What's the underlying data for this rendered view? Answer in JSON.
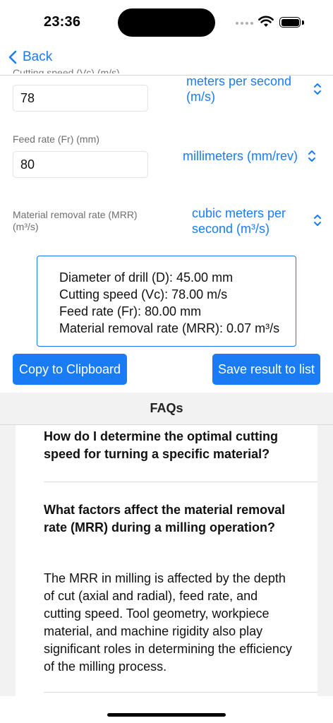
{
  "status": {
    "time": "23:36"
  },
  "nav": {
    "back_label": "Back"
  },
  "fields": {
    "cutting_speed": {
      "label_partial": "Cutting speed (Vc) (m/s)",
      "value": "78",
      "unit": "meters per second (m/s)"
    },
    "feed_rate": {
      "label": "Feed rate (Fr) (mm)",
      "value": "80",
      "unit": "millimeters (mm/rev)"
    },
    "mrr": {
      "label_line1": "Material removal rate (MRR)",
      "label_line2": "(m³/s)",
      "unit_line1": "cubic meters per",
      "unit_line2": "second (m³/s)"
    }
  },
  "result": {
    "lines": [
      "Diameter of drill (D): 45.00 mm",
      "Cutting speed (Vc): 78.00 m/s",
      "Feed rate (Fr): 80.00 mm",
      "Material removal rate (MRR): 0.07 m³/s"
    ]
  },
  "buttons": {
    "copy": "Copy to Clipboard",
    "save": "Save result to list"
  },
  "faqs": {
    "title": "FAQs",
    "items": [
      {
        "question": "How do I determine the optimal cutting speed for turning a specific material?"
      },
      {
        "question": "What factors affect the material removal rate (MRR) during a milling operation?",
        "answer": "The MRR in milling is affected by the depth of cut (axial and radial), feed rate, and cutting speed. Tool geometry, workpiece material, and machine rigidity also play significant roles in determining the efficiency of the milling process."
      }
    ]
  },
  "colors": {
    "accent": "#1a7cf5",
    "background": "#ffffff",
    "faq_background": "#f2f2f2"
  },
  "icons": [
    "back-chevron-icon",
    "wifi-icon",
    "battery-icon",
    "signal-icon",
    "updown-chevron-icon"
  ]
}
